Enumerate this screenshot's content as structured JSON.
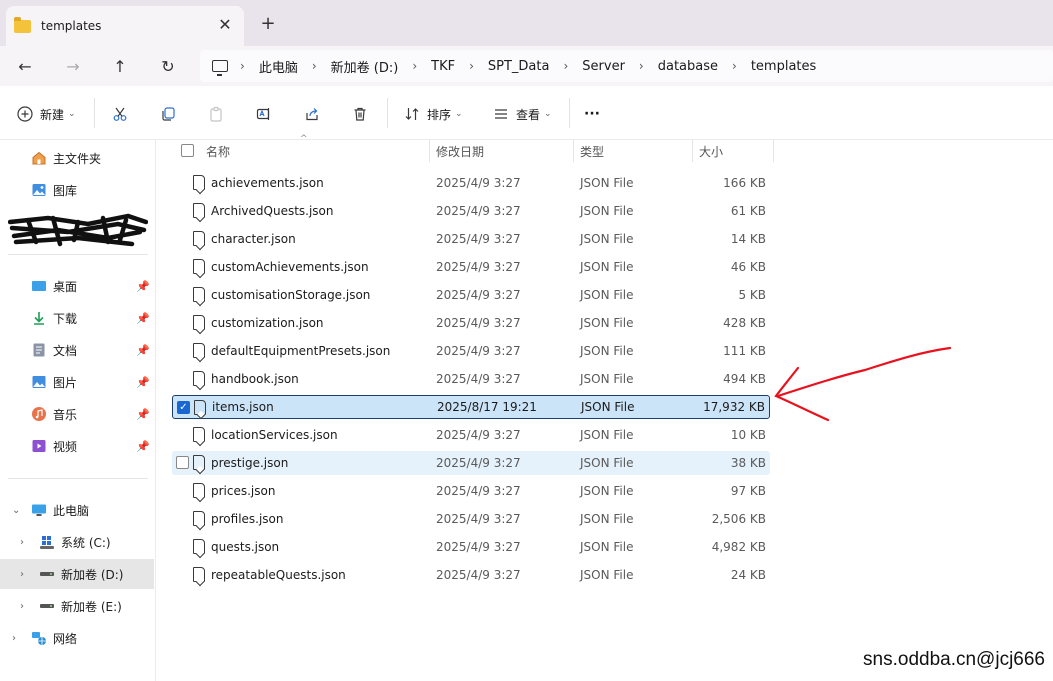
{
  "tab": {
    "title": "templates",
    "close": "✕",
    "new": "+"
  },
  "nav": {
    "back": "←",
    "forward": "→",
    "up": "↑",
    "refresh": "↻"
  },
  "breadcrumb": [
    "此电脑",
    "新加卷 (D:)",
    "TKF",
    "SPT_Data",
    "Server",
    "database",
    "templates"
  ],
  "breadcrumb_sep": "›",
  "toolbar": {
    "new_label": "新建",
    "sort_label": "排序",
    "view_label": "查看",
    "more": "···"
  },
  "sidebar": {
    "home": "主文件夹",
    "gallery": "图库",
    "pinned": [
      {
        "label": "桌面"
      },
      {
        "label": "下载"
      },
      {
        "label": "文档"
      },
      {
        "label": "图片"
      },
      {
        "label": "音乐"
      },
      {
        "label": "视频"
      }
    ],
    "this_pc": "此电脑",
    "drives": [
      {
        "label": "系统 (C:)"
      },
      {
        "label": "新加卷 (D:)"
      },
      {
        "label": "新加卷 (E:)"
      }
    ],
    "network": "网络"
  },
  "columns": {
    "name": "名称",
    "date": "修改日期",
    "type": "类型",
    "size": "大小"
  },
  "files": [
    {
      "name": "achievements.json",
      "date": "2025/4/9 3:27",
      "type": "JSON File",
      "size": "166 KB"
    },
    {
      "name": "ArchivedQuests.json",
      "date": "2025/4/9 3:27",
      "type": "JSON File",
      "size": "61 KB"
    },
    {
      "name": "character.json",
      "date": "2025/4/9 3:27",
      "type": "JSON File",
      "size": "14 KB"
    },
    {
      "name": "customAchievements.json",
      "date": "2025/4/9 3:27",
      "type": "JSON File",
      "size": "46 KB"
    },
    {
      "name": "customisationStorage.json",
      "date": "2025/4/9 3:27",
      "type": "JSON File",
      "size": "5 KB"
    },
    {
      "name": "customization.json",
      "date": "2025/4/9 3:27",
      "type": "JSON File",
      "size": "428 KB"
    },
    {
      "name": "defaultEquipmentPresets.json",
      "date": "2025/4/9 3:27",
      "type": "JSON File",
      "size": "111 KB"
    },
    {
      "name": "handbook.json",
      "date": "2025/4/9 3:27",
      "type": "JSON File",
      "size": "494 KB"
    },
    {
      "name": "items.json",
      "date": "2025/8/17 19:21",
      "type": "JSON File",
      "size": "17,932 KB"
    },
    {
      "name": "locationServices.json",
      "date": "2025/4/9 3:27",
      "type": "JSON File",
      "size": "10 KB"
    },
    {
      "name": "prestige.json",
      "date": "2025/4/9 3:27",
      "type": "JSON File",
      "size": "38 KB"
    },
    {
      "name": "prices.json",
      "date": "2025/4/9 3:27",
      "type": "JSON File",
      "size": "97 KB"
    },
    {
      "name": "profiles.json",
      "date": "2025/4/9 3:27",
      "type": "JSON File",
      "size": "2,506 KB"
    },
    {
      "name": "quests.json",
      "date": "2025/4/9 3:27",
      "type": "JSON File",
      "size": "4,982 KB"
    },
    {
      "name": "repeatableQuests.json",
      "date": "2025/4/9 3:27",
      "type": "JSON File",
      "size": "24 KB"
    }
  ],
  "selected_index": 8,
  "hover_index": 10,
  "watermark": "sns.oddba.cn@jcj666",
  "colors": {
    "selection": "#cce4f7",
    "hover": "#e5f1fb",
    "annotation_arrow": "#e8121f"
  }
}
